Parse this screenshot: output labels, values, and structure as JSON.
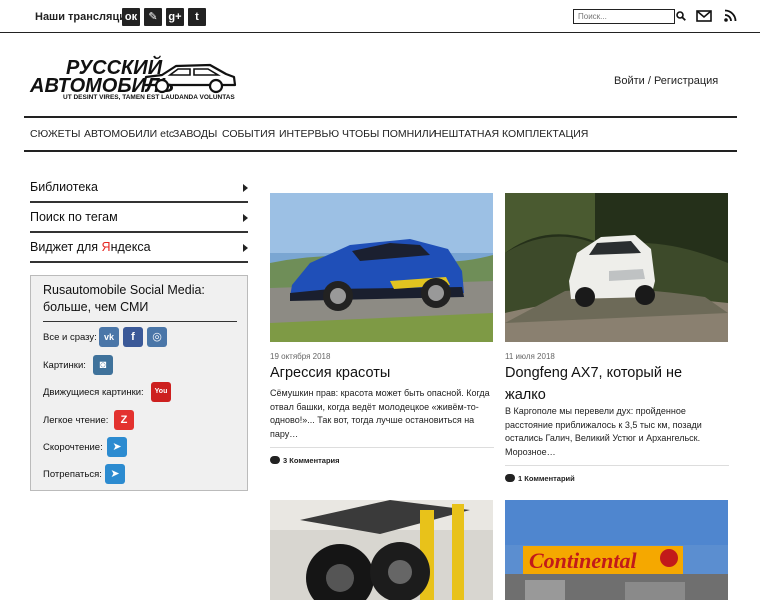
{
  "topbar": {
    "label": "Наши трансляции:",
    "social": [
      {
        "icon": "odnoklassniki-icon",
        "glyph": "ок"
      },
      {
        "icon": "livejournal-icon",
        "glyph": "✎"
      },
      {
        "icon": "googleplus-icon",
        "glyph": "g+"
      },
      {
        "icon": "twitter-icon",
        "glyph": "t"
      }
    ],
    "search_placeholder": "Поиск...",
    "icons": [
      "search-icon",
      "mail-icon",
      "rss-icon"
    ]
  },
  "header": {
    "logo_line1": "РУССКИЙ",
    "logo_line2": "АВТОМОБИЛЬ",
    "logo_motto": "UT DESINT VIRES, TAMEN EST LAUDANDA VOLUNTAS",
    "login": "Войти / Регистрация"
  },
  "nav": [
    "СЮЖЕТЫ",
    "АВТОМОБИЛИ etc",
    "ЗАВОДЫ",
    "СОБЫТИЯ",
    "ИНТЕРВЬЮ",
    "ЧТОБЫ ПОМНИЛИ",
    "НЕШТАТНАЯ КОМПЛЕКТАЦИЯ"
  ],
  "sidebar": {
    "links": [
      "Библиотека",
      "Поиск по тегам"
    ],
    "yandex_prefix": "Виджет для ",
    "yandex_y": "Я",
    "yandex_rest": "ндекса",
    "widget": {
      "title": "Rusautomobile Social Media: больше, чем СМИ",
      "rows": [
        {
          "label": "Все и сразу:",
          "icons": [
            {
              "name": "vk-icon",
              "glyph": "vk",
              "color": "#4a76a8"
            },
            {
              "name": "facebook-icon",
              "glyph": "f",
              "color": "#3b5998"
            },
            {
              "name": "opera-icon",
              "glyph": "◎",
              "color": "#4a76a8"
            }
          ]
        },
        {
          "label": "Картинки:",
          "icons": [
            {
              "name": "instagram-icon",
              "glyph": "◙",
              "color": "#3f729b"
            }
          ]
        },
        {
          "label": "Движущиеся картинки:",
          "icons": [
            {
              "name": "youtube-icon",
              "glyph": "You",
              "color": "#cd201f"
            }
          ]
        },
        {
          "label": "Легкое чтение:",
          "icons": [
            {
              "name": "zen-icon",
              "glyph": "Z",
              "color": "#e3322f"
            }
          ]
        },
        {
          "label": "Скорочтение:",
          "icons": [
            {
              "name": "telegram-icon",
              "glyph": "➤",
              "color": "#2c8bd0"
            }
          ]
        },
        {
          "label": "Потрепаться:",
          "icons": [
            {
              "name": "telegram-chat-icon",
              "glyph": "➤",
              "color": "#2c8bd0"
            }
          ]
        }
      ]
    }
  },
  "posts": [
    {
      "date": "19 октября 2018",
      "title": "Агрессия красоты",
      "excerpt": "Сёмушкин прав: красота может быть опасной. Когда отвал башки, когда ведёт молодецкое «живём-то-одново!»... Так вот, тогда лучше остановиться на пару…",
      "comments": "3 Комментария"
    },
    {
      "date": "11 июля 2018",
      "title": "Dongfeng AX7, который не жалко",
      "excerpt": "В Каргополе мы перевели дух: пройденное расстояние приближалось к 3,5 тыс км, позади остались Галич, Великий Устюг и Архангельск. Морозное…",
      "comments": "1 Комментарий"
    },
    {
      "date": "",
      "title": "",
      "excerpt": "",
      "comments": ""
    },
    {
      "date": "",
      "title": "",
      "excerpt": "",
      "comments": "",
      "sign_text": "Continental"
    }
  ],
  "colors": {
    "accent": "#222222",
    "yandex_red": "#e52620",
    "widget_bg": "#f0f0f0"
  }
}
